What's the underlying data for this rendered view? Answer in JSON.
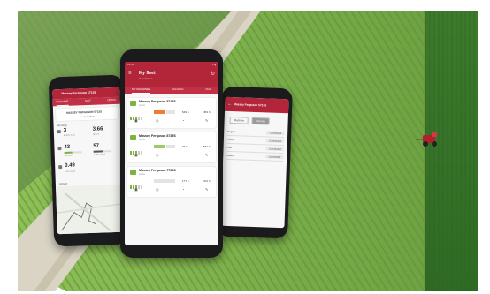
{
  "colors": {
    "brand_red": "#b3263a",
    "field_green_dark": "#3f7a2c",
    "field_green_light": "#8fbf58",
    "status_green": "#7cb342",
    "status_orange": "#f07b2a"
  },
  "main_phone": {
    "status_time": "12:30",
    "title": "My fleet",
    "subtitle": "3 machines",
    "menu_icon": "hamburger-icon",
    "refresh_icon": "refresh-icon",
    "tabs": [
      "MY MACHINES",
      "SHARED",
      "MAP"
    ],
    "machines": [
      {
        "name": "Massey Ferguson 5713S",
        "sub": "Active",
        "hours": "549 h",
        "hours2": "453 h",
        "status": "orange"
      },
      {
        "name": "Massey Ferguson 8735S",
        "sub": "Active",
        "hours": "36 h",
        "hours2": "562 h",
        "status": "green"
      },
      {
        "name": "Massey Ferguson 7726S",
        "sub": "Active",
        "hours": "177 h",
        "hours2": "472 h",
        "status": "none"
      }
    ]
  },
  "left_phone": {
    "title": "Massey Ferguson 5713S",
    "tabs": [
      "MACHINE",
      "MAP",
      "DETAIL"
    ],
    "location_title": "MASSEY FERGUSON 5713S",
    "location_sub": "Location",
    "section": "Working",
    "stats": [
      {
        "value": "3",
        "label": "Engine load"
      },
      {
        "value": "3.66",
        "label": "Speed"
      },
      {
        "value": "43",
        "label": "Fuel level"
      },
      {
        "value": "57",
        "label": "AdBlue level"
      },
      {
        "value": "0.49",
        "label": "Fuel usage"
      }
    ],
    "map_label": "Activity"
  },
  "right_phone": {
    "title": "Massey Ferguson 5713S",
    "buttons": [
      "Machine",
      "Service"
    ],
    "rows": [
      {
        "label": "Engine",
        "value": "Connected"
      },
      {
        "label": "Hours",
        "value": "Connected"
      },
      {
        "label": "Fuel",
        "value": "Connected"
      },
      {
        "label": "AdBlue",
        "value": "Connected"
      }
    ]
  }
}
